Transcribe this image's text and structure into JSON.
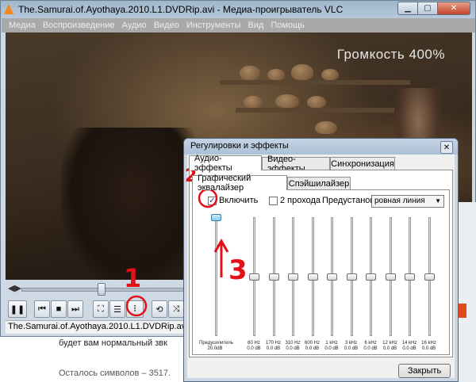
{
  "window": {
    "title": "The.Samurai.of.Ayothaya.2010.L1.DVDRip.avi - Медиа-проигрыватель VLC",
    "min_glyph": "▁",
    "max_glyph": "▢",
    "close_glyph": "✕"
  },
  "menu": [
    "Медиа",
    "Воспроизведение",
    "Аудио",
    "Видео",
    "Инструменты",
    "Вид",
    "Помощь"
  ],
  "video": {
    "osd": "Громкость 400%"
  },
  "seek": {
    "time": "◀▶",
    "progress_fraction": 0.18
  },
  "controls": {
    "pause_glyph": "❚❚",
    "prev_glyph": "⏮",
    "stop_glyph": "■",
    "next_glyph": "⏭",
    "fullscreen_glyph": "⛶",
    "playlist_glyph": "☰",
    "effects_glyph": "⫶",
    "loop_glyph": "⟲",
    "shuffle_glyph": "⤨"
  },
  "status": {
    "filename": "The.Samurai.of.Ayothaya.2010.L1.DVDRip.avi"
  },
  "background_page": {
    "line1": "будет вам нормальный звк",
    "line2": "Осталось символов – 3517."
  },
  "dialog": {
    "title": "Регулировки и эффекты",
    "close_glyph": "✕",
    "tabs": [
      "Аудио-эффекты",
      "Видео-эффекты",
      "Синхронизация"
    ],
    "subtabs": [
      "Графический эквалайзер",
      "Спэйшилайзер"
    ],
    "enable": {
      "label": "Включить",
      "checked": true,
      "mark": "✓"
    },
    "two_pass": {
      "label": "2 прохода",
      "checked": false
    },
    "preset": {
      "label": "Предустановка",
      "value": "ровная линия",
      "arrow": "▼"
    },
    "preamp": {
      "label": "Предусилитель",
      "value": "20.0dB",
      "level": 1.0
    },
    "bands": [
      {
        "freq": "60 Hz",
        "gain": "0.0 dB",
        "level": 0.5
      },
      {
        "freq": "170 Hz",
        "gain": "0.0 dB",
        "level": 0.5
      },
      {
        "freq": "310 Hz",
        "gain": "0.0 dB",
        "level": 0.5
      },
      {
        "freq": "600 Hz",
        "gain": "0.0 dB",
        "level": 0.5
      },
      {
        "freq": "1 kHz",
        "gain": "0.0 dB",
        "level": 0.5
      },
      {
        "freq": "3 kHz",
        "gain": "0.0 dB",
        "level": 0.5
      },
      {
        "freq": "6 kHz",
        "gain": "0.0 dB",
        "level": 0.5
      },
      {
        "freq": "12 kHz",
        "gain": "0.0 dB",
        "level": 0.5
      },
      {
        "freq": "14 kHz",
        "gain": "0.0 dB",
        "level": 0.5
      },
      {
        "freq": "16 kHz",
        "gain": "0.0 dB",
        "level": 0.5
      }
    ],
    "close_button": "Закрыть"
  },
  "annotations": {
    "numbers": [
      "1",
      "2",
      "3"
    ],
    "color": "#e3101a"
  }
}
